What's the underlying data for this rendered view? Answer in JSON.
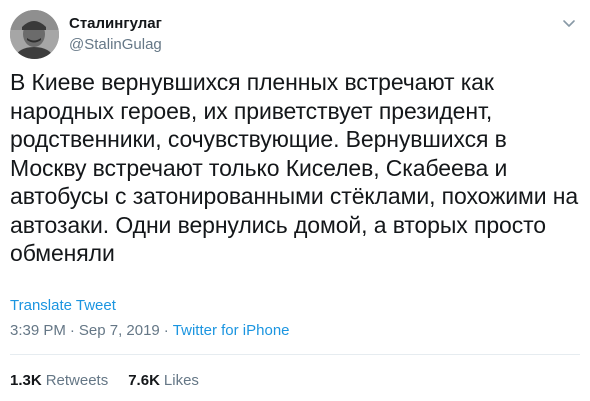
{
  "author": {
    "name": "Сталингулаг",
    "handle": "@StalinGulag"
  },
  "tweet": {
    "text": "В Киеве вернувшихся пленных встречают как\nнародных героев, их приветствует президент,\nродственники, сочувствующие. Вернувшихся в\nМоскву встречают только Киселев, Скабеева и\nавтобусы с затонированными стёклами, похожими на\nавтозаки. Одни вернулись домой, а вторых просто\nобменяли",
    "translate_label": "Translate Tweet",
    "time": "3:39 PM",
    "separator": "·",
    "date": "Sep 7, 2019",
    "source": "Twitter for iPhone"
  },
  "stats": {
    "retweets_count": "1.3K",
    "retweets_label": "Retweets",
    "likes_count": "7.6K",
    "likes_label": "Likes"
  },
  "colors": {
    "text": "#14171a",
    "secondary": "#657786",
    "link": "#1b95e0",
    "divider": "#e6ecf0"
  },
  "icons": {
    "menu": "chevron-down-icon"
  }
}
